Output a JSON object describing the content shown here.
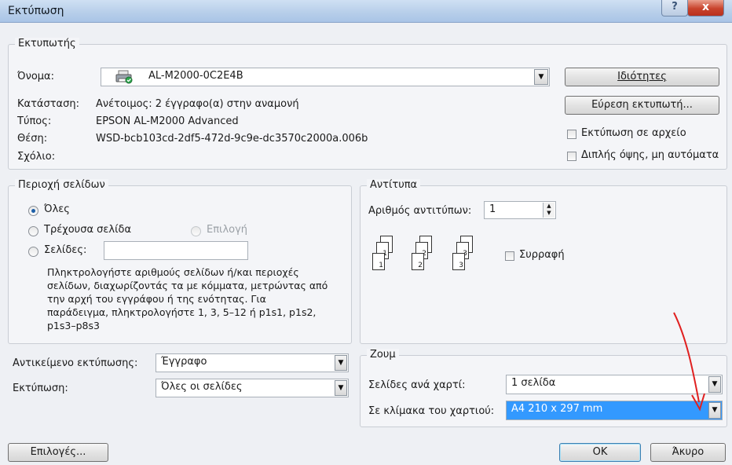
{
  "window": {
    "title": "Εκτύπωση",
    "help_glyph": "?",
    "close_glyph": "x"
  },
  "printer": {
    "group_title": "Εκτυπωτής",
    "name_label": "Όνομα:",
    "name_value": "AL-M2000-0C2E4B",
    "status_label": "Κατάσταση:",
    "status_value": "Ανέτοιμος: 2 έγγραφο(α) στην αναμονή",
    "type_label": "Τύπος:",
    "type_value": "EPSON AL-M2000 Advanced",
    "location_label": "Θέση:",
    "location_value": "WSD-bcb103cd-2df5-472d-9c9e-dc3570c2000a.006b",
    "comment_label": "Σχόλιο:",
    "properties_button": "Ιδιότητες",
    "find_printer_button": "Εύρεση εκτυπωτή...",
    "print_to_file_label": "Εκτύπωση σε αρχείο",
    "duplex_label": "Διπλής όψης, μη αυτόματα"
  },
  "page_range": {
    "group_title": "Περιοχή σελίδων",
    "all_label": "Όλες",
    "current_label": "Τρέχουσα σελίδα",
    "selection_label": "Επιλογή",
    "pages_label": "Σελίδες:",
    "pages_value": "",
    "help_text": "Πληκτρολογήστε αριθμούς σελίδων ή/και περιοχές σελίδων, διαχωρίζοντάς τα με κόμματα, μετρώντας από την αρχή του εγγράφου ή της ενότητας. Για παράδειγμα, πληκτρολογήστε 1, 3, 5–12 ή p1s1, p1s2, p1s3–p8s3"
  },
  "copies": {
    "group_title": "Αντίτυπα",
    "count_label": "Αριθμός αντιτύπων:",
    "count_value": "1",
    "collate_label": "Συρραφή",
    "page_numbers": [
      "1",
      "2",
      "3"
    ]
  },
  "print_what": {
    "label": "Αντικείμενο εκτύπωσης:",
    "value": "Έγγραφο"
  },
  "print_option": {
    "label": "Εκτύπωση:",
    "value": "Όλες οι σελίδες"
  },
  "zoom": {
    "group_title": "Ζουμ",
    "pages_per_sheet_label": "Σελίδες ανά χαρτί:",
    "pages_per_sheet_value": "1 σελίδα",
    "scale_label": "Σε κλίμακα του χαρτιού:",
    "scale_value": "A4 210 x 297 mm"
  },
  "footer": {
    "options_button": "Επιλογές...",
    "ok_button": "OK",
    "cancel_button": "Άκυρο"
  },
  "colors": {
    "accent": "#3399ff",
    "annotation_arrow": "#e02020",
    "close_red": "#c8432c"
  }
}
